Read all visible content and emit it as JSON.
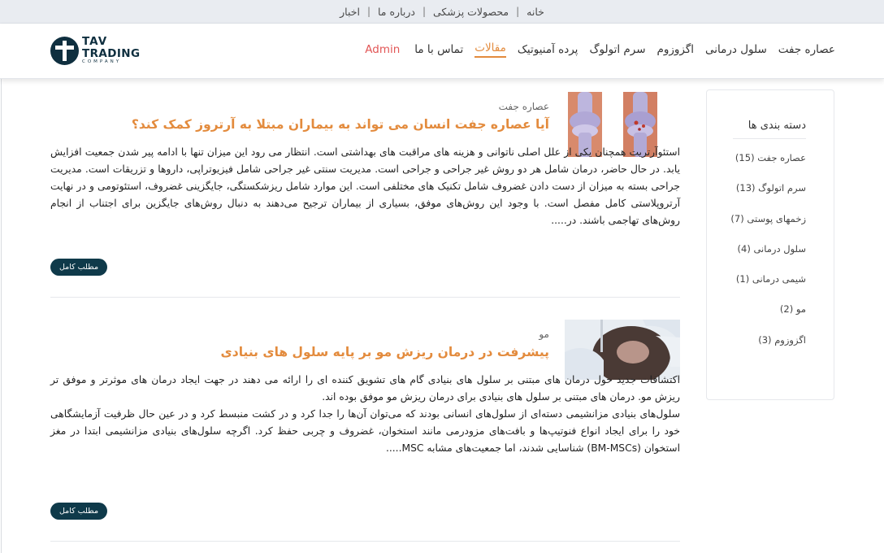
{
  "topbar": {
    "links": [
      "خانه",
      "محصولات پزشکی",
      "درباره ما",
      "اخبار"
    ]
  },
  "logo": {
    "line1": "TAV",
    "line2": "TRADING",
    "line3": "COMPANY"
  },
  "nav": {
    "items": [
      "عصاره جفت",
      "سلول درمانی",
      "اگزوزوم",
      "سرم اتولوگ",
      "پرده آمنیوتیک",
      "مقالات",
      "تماس با ما"
    ],
    "active_index": 5,
    "admin": "Admin"
  },
  "sidebar": {
    "title": "دسته بندی ها",
    "categories": [
      "عصاره جفت (15)",
      "سرم اتولوگ (13)",
      "زخمهای پوستی (7)",
      "سلول درمانی (4)",
      "شیمی درمانی (1)",
      "مو (2)",
      "اگزوزوم (3)"
    ]
  },
  "posts": [
    {
      "category": "عصاره جفت",
      "title": "آیا عصاره جفت انسان می تواند به بیماران مبتلا به آرتروز کمک کند؟",
      "excerpt": "استئوآرتریت همچنان یکی از علل اصلی ناتوانی و هزینه های مراقبت های بهداشتی است. انتظار می رود این میزان تنها با ادامه پیر شدن جمعیت افزایش یابد. در حال حاضر، درمان شامل هر دو روش غیر جراحی و جراحی است. مدیریت سنتی غیر جراحی شامل فیزیوتراپی، داروها و تزریقات است. مدیریت جراحی بسته به میزان از دست دادن غضروف شامل تکنیک های مختلفی است. این موارد شامل ریزشکستگی، جایگزینی غضروف، استئوتومی و در نهایت آرتروپلاستی کامل مفصل است. با وجود این روش‌های موفق، بسیاری از بیماران ترجیح می‌دهند به دنبال روش‌های جایگزین برای اجتناب از انجام روش‌های تهاجمی باشند. در.....",
      "read_more": "مطلب کامل"
    },
    {
      "category": "مو",
      "title": "پیشرفت در درمان ریزش مو بر پایه سلول های بنیادی",
      "excerpt_p1": "اکتشافات جدید حول درمان های مبتنی بر سلول های بنیادی گام های تشویق کننده ای را ارائه می دهند در جهت ایجاد درمان های موثرتر و موفق تر ریزش مو. درمان های مبتنی بر سلول های بنیادی برای درمان ریزش مو موفق بوده اند.",
      "excerpt_p2": "سلول‌های بنیادی مزانشیمی دسته‌ای از سلول‌های انسانی بودند که می‌توان آن‌ها را جدا کرد و در کشت منبسط کرد و در عین حال ظرفیت آزمایشگاهی خود را برای ایجاد انواع فنوتیپ‌ها و بافت‌های مزودرمی مانند استخوان، غضروف و چربی حفظ کرد. اگرچه سلول‌های بنیادی مزانشیمی ابتدا در مغز استخوان (BM-MSCs) شناسایی شدند، اما جمعیت‌های مشابه MSC.....",
      "read_more": "مطلب کامل"
    }
  ]
}
